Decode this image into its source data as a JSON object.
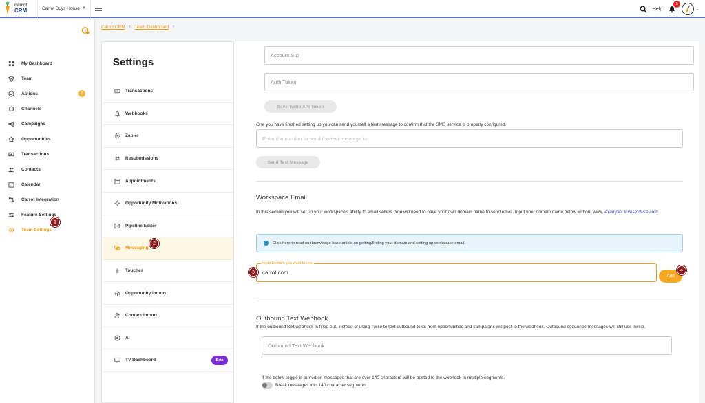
{
  "app": {
    "brand_line1": "carrot",
    "brand_line2": "CRM",
    "workspace": "Carrot Buys House",
    "help_label": "Help",
    "notification_count": "5",
    "accent_color": "#f49b0e"
  },
  "leftnav": {
    "items": [
      {
        "label": "My Dashboard",
        "icon": "grid-icon"
      },
      {
        "label": "Team",
        "icon": "layers-icon"
      },
      {
        "label": "Actions",
        "icon": "check-circle-icon",
        "count": "1"
      },
      {
        "label": "Channels",
        "icon": "puzzle-icon"
      },
      {
        "label": "Campaigns",
        "icon": "megaphone-icon"
      },
      {
        "label": "Opportunities",
        "icon": "home-icon"
      },
      {
        "label": "Transactions",
        "icon": "money-icon"
      },
      {
        "label": "Contacts",
        "icon": "users-icon"
      },
      {
        "label": "Calendar",
        "icon": "calendar-icon"
      },
      {
        "label": "Carrot Integration",
        "icon": "integration-icon"
      },
      {
        "label": "Feature Settings",
        "icon": "sliders-icon"
      },
      {
        "label": "Team Settings",
        "icon": "gear-icon",
        "active": true
      }
    ]
  },
  "steps": [
    "1",
    "2",
    "3",
    "4"
  ],
  "breadcrumb": [
    "Carrot CRM",
    "Team Dashboard"
  ],
  "settings": {
    "title": "Settings",
    "items": [
      {
        "label": "Transactions",
        "icon": "money-icon"
      },
      {
        "label": "Webhooks",
        "icon": "bell-icon"
      },
      {
        "label": "Zapier",
        "icon": "gear-icon"
      },
      {
        "label": "Resubmissions",
        "icon": "arrows-icon"
      },
      {
        "label": "Appointments",
        "icon": "calendar-icon"
      },
      {
        "label": "Opportunity Motivations",
        "icon": "sun-icon"
      },
      {
        "label": "Pipeline Editor",
        "icon": "edit-icon"
      },
      {
        "label": "Messaging",
        "icon": "chat-icon",
        "active": true
      },
      {
        "label": "Touches",
        "icon": "hand-icon"
      },
      {
        "label": "Opportunity Import",
        "icon": "cloud-upload-icon"
      },
      {
        "label": "Contact Import",
        "icon": "user-plus-icon"
      },
      {
        "label": "AI",
        "icon": "ai-icon"
      },
      {
        "label": "TV Dashboard",
        "icon": "tv-icon",
        "badge": "Beta"
      }
    ]
  },
  "twilio": {
    "account_sid_placeholder": "Account SID",
    "auth_token_placeholder": "Auth Token",
    "save_button": "Save Twilio API Token",
    "test_help": "One you have finished setting up you can send yourself a test message to confirm that the SMS service is properly configured.",
    "test_placeholder": "Enter the number to send the test message to",
    "send_button": "Send Test Message"
  },
  "workspace_email": {
    "title": "Workspace Email",
    "description": "In this section you will set up your workspace's ability to email sellers. You will need to have your own domain name to send email. Input your domain name below without www.",
    "example": "example: investorfuse.com",
    "info": "Click here to read our knowledge base article on getting/finding your domain and setting up workspace email.",
    "domain_label": "Input Domain you want to use",
    "domain_value": "carrot.com",
    "add_button": "Add"
  },
  "outbound": {
    "title": "Outbound Text Webhook",
    "description": "If the outbound text webhook is filled out. instead of using Twilio to text outbound texts from opportunities and campaigns will post to the webhook. Outbound sequence messages will still use Twilio.",
    "webhook_placeholder": "Outbound Text Webhook",
    "toggle_help": "If the below toggle is turned on messages that are over 140 characters will be posted to the webhook in multiple segments.",
    "toggle_label": "Break messages into 140 character segments"
  }
}
